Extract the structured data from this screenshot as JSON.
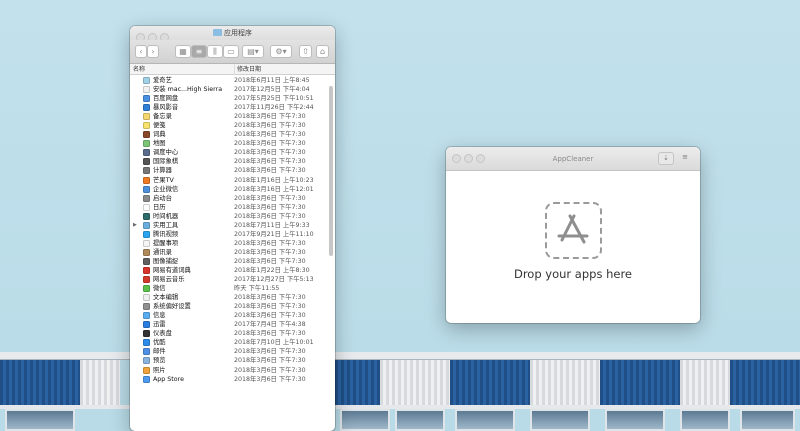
{
  "finder": {
    "title": "应用程序",
    "col_name": "名称",
    "col_date": "修改日期",
    "rows": [
      {
        "name": "爱奇艺",
        "date": "2018年6月11日 上午8:45",
        "color": "#9fd0e6"
      },
      {
        "name": "安装 mac...High Sierra",
        "date": "2017年12月5日 下午4:04",
        "color": "#f2f2f2"
      },
      {
        "name": "百度网盘",
        "date": "2017年5月25日 下午10:51",
        "color": "#4a90e2"
      },
      {
        "name": "暴风影音",
        "date": "2017年11月26日 下午2:44",
        "color": "#2f7fd6"
      },
      {
        "name": "备忘录",
        "date": "2018年3月6日 下午7:30",
        "color": "#f5d76e"
      },
      {
        "name": "便笺",
        "date": "2018年3月6日 下午7:30",
        "color": "#f7e36b"
      },
      {
        "name": "词典",
        "date": "2018年3月6日 下午7:30",
        "color": "#8a4a2a"
      },
      {
        "name": "地图",
        "date": "2018年3月6日 下午7:30",
        "color": "#7cc576"
      },
      {
        "name": "调度中心",
        "date": "2018年3月6日 下午7:30",
        "color": "#5a6b8c"
      },
      {
        "name": "国际象棋",
        "date": "2018年3月6日 下午7:30",
        "color": "#555555"
      },
      {
        "name": "计算器",
        "date": "2018年3月6日 下午7:30",
        "color": "#777777"
      },
      {
        "name": "芒果TV",
        "date": "2018年1月16日 上午10:23",
        "color": "#f07a22"
      },
      {
        "name": "企业微信",
        "date": "2018年3月16日 上午12:01",
        "color": "#4c8fdb"
      },
      {
        "name": "启动台",
        "date": "2018年3月6日 下午7:30",
        "color": "#8a8a8a"
      },
      {
        "name": "日历",
        "date": "2018年3月6日 下午7:30",
        "color": "#ffffff"
      },
      {
        "name": "时间机器",
        "date": "2018年3月6日 下午7:30",
        "color": "#2e6b6b"
      },
      {
        "name": "实用工具",
        "date": "2018年7月11日 上午9:33",
        "color": "#6aaee0"
      },
      {
        "name": "腾讯视频",
        "date": "2017年9月21日 上午11:10",
        "color": "#2aa5ef"
      },
      {
        "name": "提醒事项",
        "date": "2018年3月6日 下午7:30",
        "color": "#f5f5f5"
      },
      {
        "name": "通讯录",
        "date": "2018年3月6日 下午7:30",
        "color": "#b08a5a"
      },
      {
        "name": "图像捕捉",
        "date": "2018年3月6日 下午7:30",
        "color": "#606060"
      },
      {
        "name": "网易有道词典",
        "date": "2018年1月22日 上午8:30",
        "color": "#d9342b"
      },
      {
        "name": "网易云音乐",
        "date": "2017年12月27日 下午5:13",
        "color": "#d33a2c"
      },
      {
        "name": "微信",
        "date": "昨天 下午11:55",
        "color": "#5ac24b"
      },
      {
        "name": "文本编辑",
        "date": "2018年3月6日 下午7:30",
        "color": "#f0f0f0"
      },
      {
        "name": "系统偏好设置",
        "date": "2018年3月6日 下午7:30",
        "color": "#8f8f8f"
      },
      {
        "name": "信息",
        "date": "2018年3月6日 下午7:30",
        "color": "#5aaef0"
      },
      {
        "name": "迅雷",
        "date": "2017年7月4日 下午4:38",
        "color": "#2b7ee0"
      },
      {
        "name": "仪表盘",
        "date": "2018年3月6日 下午7:30",
        "color": "#333333"
      },
      {
        "name": "优酷",
        "date": "2018年7月10日 上午10:01",
        "color": "#2c8de8"
      },
      {
        "name": "邮件",
        "date": "2018年3月6日 下午7:30",
        "color": "#4d90e6"
      },
      {
        "name": "预览",
        "date": "2018年3月6日 下午7:30",
        "color": "#8ab4e0"
      },
      {
        "name": "照片",
        "date": "2018年3月6日 下午7:30",
        "color": "#f0a33a"
      },
      {
        "name": "App Store",
        "date": "2018年3月6日 下午7:30",
        "color": "#4d9aef"
      }
    ]
  },
  "appcleaner": {
    "title": "AppCleaner",
    "drop_text": "Drop your apps here"
  }
}
